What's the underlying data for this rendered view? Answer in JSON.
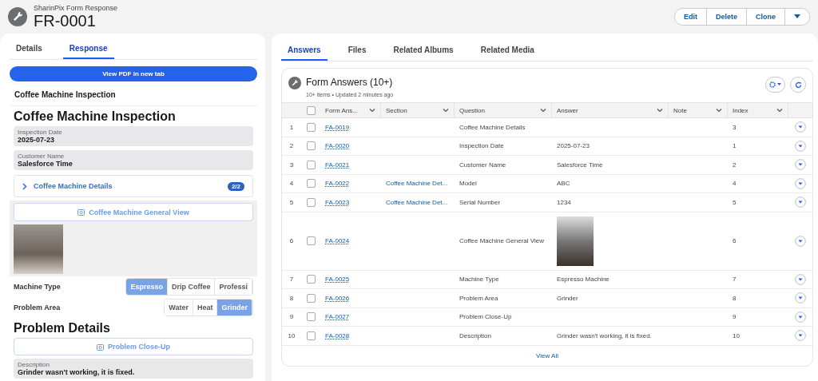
{
  "header": {
    "subtitle": "SharinPix Form Response",
    "title": "FR-0001",
    "actions": [
      "Edit",
      "Delete",
      "Clone"
    ]
  },
  "left": {
    "tabs": [
      {
        "label": "Details",
        "selected": false
      },
      {
        "label": "Response",
        "selected": true
      }
    ],
    "pdf_button": "View PDF in new tab",
    "form_title": "Coffee Machine Inspection",
    "items": [
      {
        "kind": "heading",
        "text": "Coffee Machine Inspection"
      },
      {
        "kind": "field",
        "label": "Inspection Date",
        "value": "2025-07-23"
      },
      {
        "kind": "field",
        "label": "Customer Name",
        "value": "Salesforce Time"
      },
      {
        "kind": "section",
        "label": "Coffee Machine Details",
        "count": "2/2"
      },
      {
        "kind": "photo",
        "label": "Coffee Machine General View"
      },
      {
        "kind": "choice",
        "label": "Machine Type",
        "options": [
          {
            "label": "Espresso",
            "selected": true
          },
          {
            "label": "Drip Coffee",
            "selected": false
          },
          {
            "label": "Professi",
            "selected": false
          }
        ]
      },
      {
        "kind": "choice",
        "label": "Problem Area",
        "options": [
          {
            "label": "Water",
            "selected": false
          },
          {
            "label": "Heat",
            "selected": false
          },
          {
            "label": "Grinder",
            "selected": true
          }
        ]
      },
      {
        "kind": "heading",
        "text": "Problem Details"
      },
      {
        "kind": "upload",
        "label": "Problem Close-Up"
      },
      {
        "kind": "field",
        "label": "Description",
        "value": "Grinder wasn't working, it is fixed."
      }
    ]
  },
  "right": {
    "tabs": [
      {
        "label": "Answers",
        "selected": true
      },
      {
        "label": "Files",
        "selected": false
      },
      {
        "label": "Related Albums",
        "selected": false
      },
      {
        "label": "Related Media",
        "selected": false
      }
    ],
    "card_title": "Form Answers (10+)",
    "meta": "10+ items • Updated 2 minutes ago",
    "all_checked": false,
    "columns": [
      "Form Ans...",
      "Section",
      "Question",
      "Answer",
      "Note",
      "Index"
    ],
    "rows": [
      {
        "num": "1",
        "name": "FA-0019",
        "section": "",
        "question": "Coffee Machine Details",
        "kind": "text",
        "answer": "",
        "index": "3",
        "checked": false
      },
      {
        "num": "2",
        "name": "FA-0020",
        "section": "",
        "question": "Inspection Date",
        "kind": "text",
        "answer": "2025-07-23",
        "index": "1",
        "checked": false
      },
      {
        "num": "3",
        "name": "FA-0021",
        "section": "",
        "question": "Customer Name",
        "kind": "text",
        "answer": "Salesforce Time",
        "index": "2",
        "checked": false
      },
      {
        "num": "4",
        "name": "FA-0022",
        "section": "Coffee Machine Det...",
        "question": "Model",
        "kind": "text",
        "answer": "ABC",
        "index": "4",
        "checked": false
      },
      {
        "num": "5",
        "name": "FA-0023",
        "section": "Coffee Machine Det...",
        "question": "Serial Number",
        "kind": "text",
        "answer": "1234",
        "index": "5",
        "checked": false
      },
      {
        "num": "6",
        "name": "FA-0024",
        "section": "",
        "question": "Coffee Machine General View",
        "kind": "photo",
        "answer": "",
        "index": "6",
        "checked": false
      },
      {
        "num": "7",
        "name": "FA-0025",
        "section": "",
        "question": "Machine Type",
        "kind": "text",
        "answer": "Espresso Machine",
        "index": "7",
        "checked": false
      },
      {
        "num": "8",
        "name": "FA-0026",
        "section": "",
        "question": "Problem Area",
        "kind": "text",
        "answer": "Grinder",
        "index": "8",
        "checked": false
      },
      {
        "num": "9",
        "name": "FA-0027",
        "section": "",
        "question": "Problem Close-Up",
        "kind": "text",
        "answer": "",
        "index": "9",
        "checked": false
      },
      {
        "num": "10",
        "name": "FA-0028",
        "section": "",
        "question": "Description",
        "kind": "text",
        "answer": "Grinder wasn't working, it is fixed.",
        "index": "10",
        "checked": false
      }
    ],
    "view_all": "View All"
  }
}
